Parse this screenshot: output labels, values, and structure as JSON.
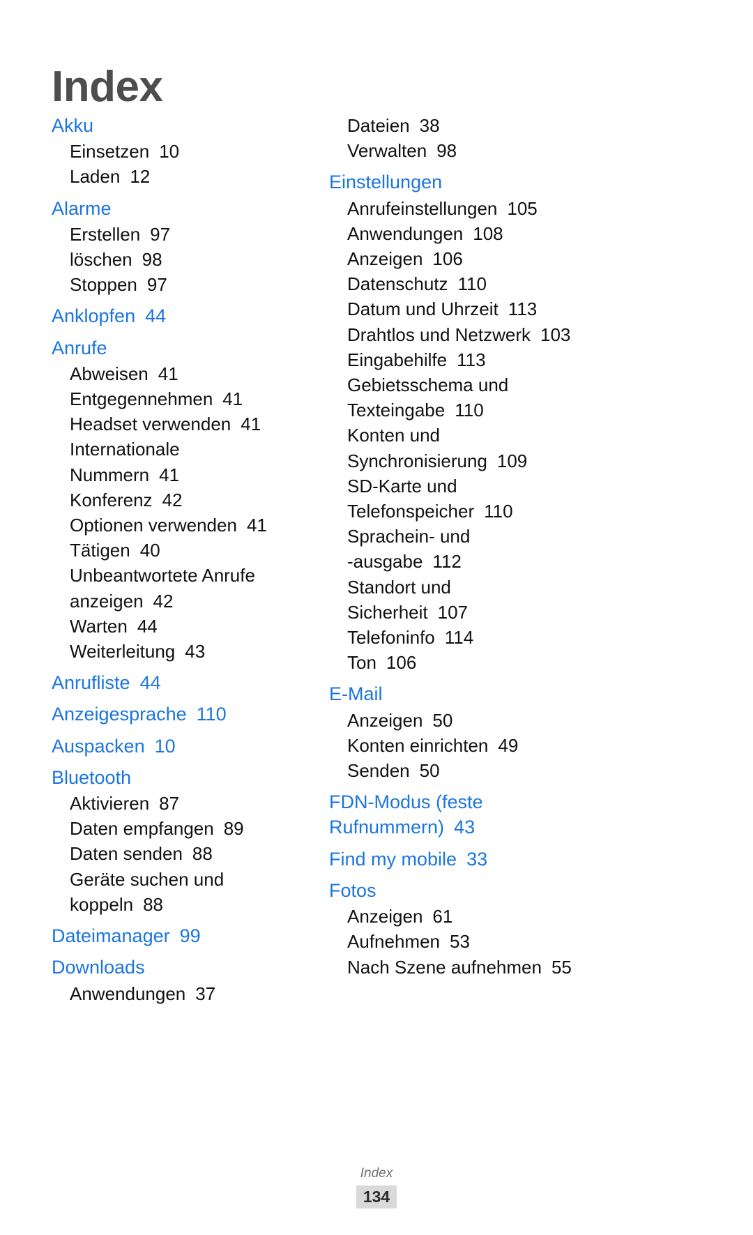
{
  "document": {
    "title": "Index",
    "footer": {
      "label": "Index",
      "page_number": "134"
    },
    "colors": {
      "heading": "#1b75e0",
      "body": "#111111",
      "title": "#4d4d4d",
      "page_badge_bg": "#d9d9d9"
    }
  },
  "left_column": [
    {
      "type": "head",
      "label": "Akku",
      "page": ""
    },
    {
      "type": "sub",
      "label": "Einsetzen",
      "page": "10"
    },
    {
      "type": "sub",
      "label": "Laden",
      "page": "12"
    },
    {
      "type": "head",
      "label": "Alarme",
      "page": ""
    },
    {
      "type": "sub",
      "label": "Erstellen",
      "page": "97"
    },
    {
      "type": "sub",
      "label": "löschen",
      "page": "98"
    },
    {
      "type": "sub",
      "label": "Stoppen",
      "page": "97"
    },
    {
      "type": "head",
      "label": "Anklopfen",
      "page": "44"
    },
    {
      "type": "head",
      "label": "Anrufe",
      "page": ""
    },
    {
      "type": "sub",
      "label": "Abweisen",
      "page": "41"
    },
    {
      "type": "sub",
      "label": "Entgegennehmen",
      "page": "41"
    },
    {
      "type": "sub",
      "label": "Headset verwenden",
      "page": "41"
    },
    {
      "type": "sub",
      "label": "Internationale",
      "page": ""
    },
    {
      "type": "sub",
      "label": "Nummern",
      "page": "41"
    },
    {
      "type": "sub",
      "label": "Konferenz",
      "page": "42"
    },
    {
      "type": "sub",
      "label": "Optionen verwenden",
      "page": "41"
    },
    {
      "type": "sub",
      "label": "Tätigen",
      "page": "40"
    },
    {
      "type": "sub",
      "label": "Unbeantwortete Anrufe",
      "page": ""
    },
    {
      "type": "sub",
      "label": "anzeigen",
      "page": "42"
    },
    {
      "type": "sub",
      "label": "Warten",
      "page": "44"
    },
    {
      "type": "sub",
      "label": "Weiterleitung",
      "page": "43"
    },
    {
      "type": "head",
      "label": "Anrufliste",
      "page": "44"
    },
    {
      "type": "head",
      "label": "Anzeigesprache",
      "page": "110"
    },
    {
      "type": "head",
      "label": "Auspacken",
      "page": "10"
    },
    {
      "type": "head",
      "label": "Bluetooth",
      "page": ""
    },
    {
      "type": "sub",
      "label": "Aktivieren",
      "page": "87"
    },
    {
      "type": "sub",
      "label": "Daten empfangen",
      "page": "89"
    },
    {
      "type": "sub",
      "label": "Daten senden",
      "page": "88"
    },
    {
      "type": "sub",
      "label": "Geräte suchen und",
      "page": ""
    },
    {
      "type": "sub",
      "label": "koppeln",
      "page": "88"
    },
    {
      "type": "head",
      "label": "Dateimanager",
      "page": "99"
    },
    {
      "type": "head",
      "label": "Downloads",
      "page": ""
    },
    {
      "type": "sub",
      "label": "Anwendungen",
      "page": "37"
    }
  ],
  "right_column": [
    {
      "type": "sub",
      "label": "Dateien",
      "page": "38"
    },
    {
      "type": "sub",
      "label": "Verwalten",
      "page": "98"
    },
    {
      "type": "head",
      "label": "Einstellungen",
      "page": ""
    },
    {
      "type": "sub",
      "label": "Anrufeinstellungen",
      "page": "105"
    },
    {
      "type": "sub",
      "label": "Anwendungen",
      "page": "108"
    },
    {
      "type": "sub",
      "label": "Anzeigen",
      "page": "106"
    },
    {
      "type": "sub",
      "label": "Datenschutz",
      "page": "110"
    },
    {
      "type": "sub",
      "label": "Datum und Uhrzeit",
      "page": "113"
    },
    {
      "type": "sub",
      "label": "Drahtlos und Netzwerk",
      "page": "103"
    },
    {
      "type": "sub",
      "label": "Eingabehilfe",
      "page": "113"
    },
    {
      "type": "sub",
      "label": "Gebietsschema und",
      "page": ""
    },
    {
      "type": "sub",
      "label": "Texteingabe",
      "page": "110"
    },
    {
      "type": "sub",
      "label": "Konten und",
      "page": ""
    },
    {
      "type": "sub",
      "label": "Synchronisierung",
      "page": "109"
    },
    {
      "type": "sub",
      "label": "SD-Karte und",
      "page": ""
    },
    {
      "type": "sub",
      "label": "Telefonspeicher",
      "page": "110"
    },
    {
      "type": "sub",
      "label": "Sprachein- und",
      "page": ""
    },
    {
      "type": "sub",
      "label": "-ausgabe",
      "page": "112"
    },
    {
      "type": "sub",
      "label": "Standort und",
      "page": ""
    },
    {
      "type": "sub",
      "label": "Sicherheit",
      "page": "107"
    },
    {
      "type": "sub",
      "label": "Telefoninfo",
      "page": "114"
    },
    {
      "type": "sub",
      "label": "Ton",
      "page": "106"
    },
    {
      "type": "head",
      "label": "E-Mail",
      "page": ""
    },
    {
      "type": "sub",
      "label": "Anzeigen",
      "page": "50"
    },
    {
      "type": "sub",
      "label": "Konten einrichten",
      "page": "49"
    },
    {
      "type": "sub",
      "label": "Senden",
      "page": "50"
    },
    {
      "type": "head",
      "label": "FDN-Modus (feste Rufnummern)",
      "page": "43",
      "wrap": true
    },
    {
      "type": "head",
      "label": "Find my mobile",
      "page": "33"
    },
    {
      "type": "head",
      "label": "Fotos",
      "page": ""
    },
    {
      "type": "sub",
      "label": "Anzeigen",
      "page": "61"
    },
    {
      "type": "sub",
      "label": "Aufnehmen",
      "page": "53"
    },
    {
      "type": "sub",
      "label": "Nach Szene aufnehmen",
      "page": "55"
    }
  ]
}
